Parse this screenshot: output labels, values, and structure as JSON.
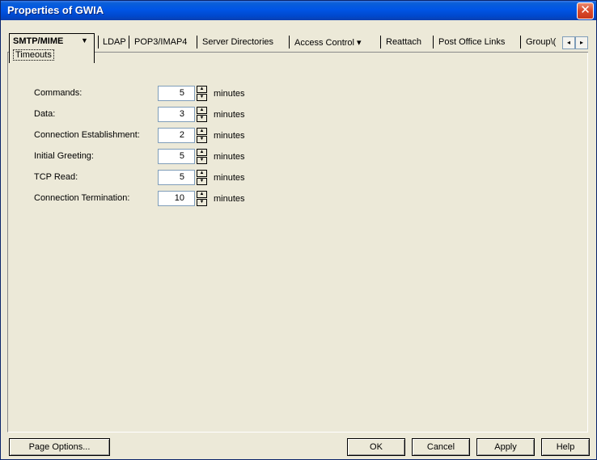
{
  "window": {
    "title": "Properties of GWIA",
    "close_glyph": "✕"
  },
  "tabs": {
    "active": {
      "label": "SMTP/MIME",
      "sub_label": "Timeouts",
      "has_dropdown": true
    },
    "items": [
      {
        "label": "LDAP"
      },
      {
        "label": "POP3/IMAP4"
      },
      {
        "label": "Server Directories"
      },
      {
        "label": "Access Control ▾"
      },
      {
        "label": "Reattach"
      },
      {
        "label": "Post Office Links"
      },
      {
        "label": "Group\\("
      }
    ],
    "scroll_left": "◂",
    "scroll_right": "▸"
  },
  "timeouts": {
    "unit": "minutes",
    "rows": [
      {
        "label": "Commands:",
        "value": "5"
      },
      {
        "label": "Data:",
        "value": "3"
      },
      {
        "label": "Connection Establishment:",
        "value": "2"
      },
      {
        "label": "Initial Greeting:",
        "value": "5"
      },
      {
        "label": "TCP Read:",
        "value": "5"
      },
      {
        "label": "Connection Termination:",
        "value": "10"
      }
    ]
  },
  "buttons": {
    "page_options": "Page Options...",
    "ok": "OK",
    "cancel": "Cancel",
    "apply": "Apply",
    "help": "Help"
  }
}
